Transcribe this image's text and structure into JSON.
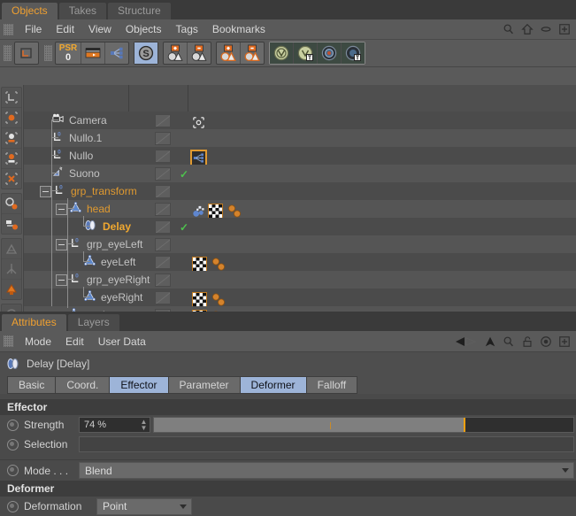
{
  "object_manager": {
    "tabs": [
      {
        "label": "Objects",
        "active": true
      },
      {
        "label": "Takes",
        "active": false
      },
      {
        "label": "Structure",
        "active": false
      }
    ],
    "menu": [
      "File",
      "Edit",
      "View",
      "Objects",
      "Tags",
      "Bookmarks"
    ],
    "menu_icons": [
      "search-icon",
      "home-icon",
      "ellipse-icon",
      "plus-icon"
    ],
    "toolbar": {
      "psr_label": "PSR",
      "psr_value": "0",
      "buttons": [
        "layout-icon",
        "psr-icon",
        "timeline-icon",
        "hierarchy-icon",
        "solo-icon",
        "add-object-icon",
        "remove-object-icon",
        "add-selection-icon",
        "remove-selection-icon",
        "fold-all-icon",
        "fold-tags-icon",
        "unfold-all-icon",
        "unfold-tags-icon"
      ]
    },
    "rows": [
      {
        "name": "Camera",
        "type": "camera-icon",
        "indent": 1,
        "expander": false,
        "color": "grey",
        "dot_red": false,
        "check": false,
        "tags": [
          "target-tag"
        ],
        "tag_selected": -1
      },
      {
        "name": "Nullo.1",
        "type": "null-icon",
        "indent": 1,
        "expander": false,
        "color": "grey",
        "dot_red": false,
        "check": false,
        "tags": [],
        "tag_selected": -1
      },
      {
        "name": "Nullo",
        "type": "null-icon",
        "indent": 1,
        "expander": false,
        "color": "grey",
        "dot_red": false,
        "check": false,
        "tags": [
          "xpresso-tag"
        ],
        "tag_selected": 0
      },
      {
        "name": "Suono",
        "type": "light-icon",
        "indent": 1,
        "expander": false,
        "color": "grey",
        "dot_red": true,
        "check": true,
        "tags": [],
        "tag_selected": -1
      },
      {
        "name": "grp_transform",
        "type": "null-icon",
        "indent": 1,
        "expander": true,
        "color": "orange",
        "dot_red": false,
        "check": false,
        "tags": [],
        "tag_selected": -1
      },
      {
        "name": "head",
        "type": "polygon-icon",
        "indent": 2,
        "expander": true,
        "color": "orange",
        "dot_red": false,
        "check": false,
        "tags": [
          "mograph-tag",
          "texture-tag",
          "point-tag"
        ],
        "tag_selected": -1
      },
      {
        "name": "Delay",
        "type": "delay-icon",
        "indent": 3,
        "expander": false,
        "color": "orangeb",
        "dot_red": false,
        "check": true,
        "tags": [],
        "tag_selected": -1
      },
      {
        "name": "grp_eyeLeft",
        "type": "null-icon",
        "indent": 2,
        "expander": true,
        "color": "grey",
        "dot_red": false,
        "check": false,
        "tags": [],
        "tag_selected": -1
      },
      {
        "name": "eyeLeft",
        "type": "polygon-icon",
        "indent": 3,
        "expander": false,
        "color": "grey",
        "dot_red": false,
        "check": false,
        "tags": [
          "texture-tag",
          "point-tag"
        ],
        "tag_selected": -1
      },
      {
        "name": "grp_eyeRight",
        "type": "null-icon",
        "indent": 2,
        "expander": true,
        "color": "grey",
        "dot_red": false,
        "check": false,
        "tags": [],
        "tag_selected": -1
      },
      {
        "name": "eyeRight",
        "type": "polygon-icon",
        "indent": 3,
        "expander": false,
        "color": "grey",
        "dot_red": false,
        "check": false,
        "tags": [
          "texture-tag",
          "point-tag"
        ],
        "tag_selected": -1
      },
      {
        "name": "teeth",
        "type": "polygon-icon",
        "indent": 2,
        "expander": false,
        "color": "grey",
        "dot_red": false,
        "check": false,
        "tags": [
          "texture-tag",
          "point-tag"
        ],
        "tag_selected": -1
      }
    ]
  },
  "attributes": {
    "tabs": [
      {
        "label": "Attributes",
        "active": true
      },
      {
        "label": "Layers",
        "active": false
      }
    ],
    "menu": [
      "Mode",
      "Edit",
      "User Data"
    ],
    "menu_icons": [
      "back-arrow-icon",
      "forward-arrow-icon",
      "up-arrow-icon",
      "search-icon",
      "lock-icon",
      "target-icon",
      "plus-icon"
    ],
    "object_title": "Delay [Delay]",
    "object_icon": "delay-icon",
    "property_tabs": [
      {
        "label": "Basic",
        "on": false
      },
      {
        "label": "Coord.",
        "on": false
      },
      {
        "label": "Effector",
        "on": true
      },
      {
        "label": "Parameter",
        "on": false
      },
      {
        "label": "Deformer",
        "on": true
      },
      {
        "label": "Falloff",
        "on": false
      }
    ],
    "effector": {
      "section": "Effector",
      "strength_label": "Strength",
      "strength_value": "74 %",
      "strength_percent": 74,
      "selection_label": "Selection",
      "selection_value": "",
      "mode_label": "Mode . . .",
      "mode_value": "Blend"
    },
    "deformer": {
      "section": "Deformer",
      "deformation_label": "Deformation",
      "deformation_value": "Point"
    }
  },
  "colors": {
    "accent_orange": "#e09a30",
    "tab_blue": "#9db4d8",
    "slider_marker": "#f0a010",
    "check_green": "#4ec24e",
    "dot_red": "#e05a4a"
  }
}
